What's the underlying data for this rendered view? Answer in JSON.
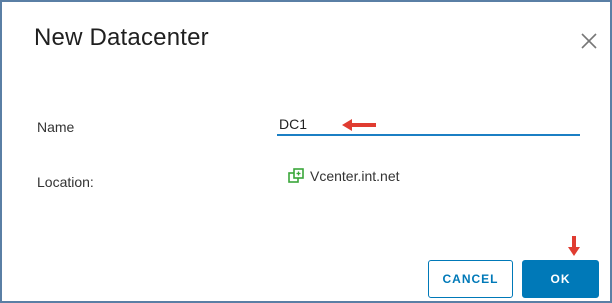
{
  "dialog": {
    "title": "New Datacenter",
    "close_icon": "close-icon"
  },
  "form": {
    "name_label": "Name",
    "name_value": "DC1",
    "location_label": "Location:",
    "location_value": "Vcenter.int.net",
    "location_icon": "vcenter-icon"
  },
  "buttons": {
    "cancel_label": "CANCEL",
    "ok_label": "OK"
  },
  "annotations": {
    "arrow_color": "#e03c31"
  },
  "colors": {
    "accent": "#0079b8",
    "icon_green": "#3aa63a"
  }
}
